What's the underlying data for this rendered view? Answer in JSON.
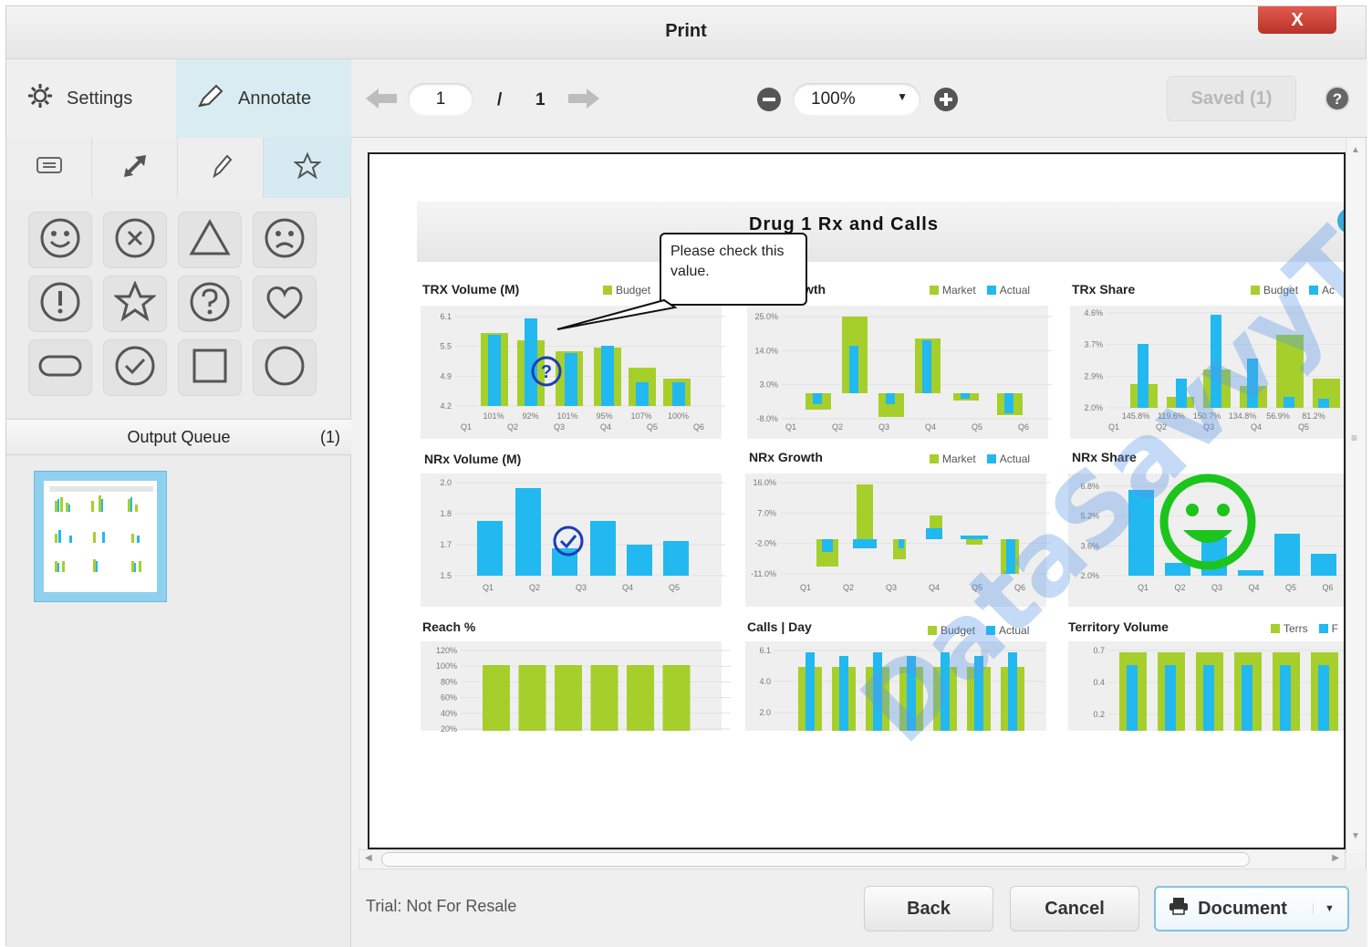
{
  "window": {
    "title": "Print",
    "close_label": "X"
  },
  "left_tabs": {
    "settings_label": "Settings",
    "annotate_label": "Annotate"
  },
  "tools": [
    "comment-icon",
    "arrow-icon",
    "pencil-icon",
    "star-icon"
  ],
  "stamps": [
    "smile",
    "x-circle",
    "triangle",
    "frown",
    "exclamation",
    "star",
    "question",
    "heart",
    "pill",
    "check",
    "square",
    "circle"
  ],
  "queue": {
    "label": "Output Queue",
    "count": "(1)"
  },
  "toolbar": {
    "page": "1",
    "separator": "/",
    "total_pages": "1",
    "zoom": "100%",
    "saved_label": "Saved (1)"
  },
  "dashboard": {
    "title": "Drug 1 Rx and Calls",
    "callout": "Please check this value.",
    "watermark": "DataSavvyTools.com",
    "panels": {
      "trx_volume": {
        "title": "TRX Volume (M)",
        "legend": [
          "Budget"
        ],
        "y_ticks": [
          "6.1",
          "5.5",
          "4.9",
          "4.2"
        ],
        "x": [
          "Q1",
          "Q2",
          "Q3",
          "Q4",
          "Q5",
          "Q6"
        ],
        "pct": [
          "101%",
          "92%",
          "101%",
          "95%",
          "107%",
          "100%"
        ]
      },
      "trx_growth": {
        "title": "wth",
        "legend": [
          "Market",
          "Actual"
        ],
        "y_ticks": [
          "25.0%",
          "14.0%",
          "3.0%",
          "-8.0%"
        ],
        "x": [
          "Q1",
          "Q2",
          "Q3",
          "Q4",
          "Q5",
          "Q6"
        ]
      },
      "trx_share": {
        "title": "TRx Share",
        "legend": [
          "Budget",
          "Ac"
        ],
        "y_ticks": [
          "4.6%",
          "3.7%",
          "2.9%",
          "2.0%"
        ],
        "x": [
          "Q1",
          "Q2",
          "Q3",
          "Q4",
          "Q5"
        ],
        "pct": [
          "145.8%",
          "119.6%",
          "150.7%",
          "134.8%",
          "56.9%",
          "81.2%"
        ]
      },
      "nrx_volume": {
        "title": "NRx Volume (M)",
        "y_ticks": [
          "2.0",
          "1.8",
          "1.7",
          "1.5"
        ],
        "x": [
          "Q1",
          "Q2",
          "Q3",
          "Q4",
          "Q5"
        ]
      },
      "nrx_growth": {
        "title": "NRx Growth",
        "legend": [
          "Market",
          "Actual"
        ],
        "y_ticks": [
          "16.0%",
          "7.0%",
          "-2.0%",
          "-11.0%"
        ],
        "x": [
          "Q1",
          "Q2",
          "Q3",
          "Q4",
          "Q5",
          "Q6"
        ]
      },
      "nrx_share": {
        "title": "NRx Share",
        "y_ticks": [
          "6.8%",
          "5.2%",
          "3.6%",
          "2.0%"
        ],
        "x": [
          "Q1",
          "Q2",
          "Q3",
          "Q4",
          "Q5",
          "Q6"
        ]
      },
      "reach": {
        "title": "Reach %",
        "y_ticks": [
          "120%",
          "100%",
          "80%",
          "60%",
          "40%",
          "20%"
        ]
      },
      "calls_day": {
        "title": "Calls | Day",
        "legend": [
          "Budget",
          "Actual"
        ],
        "y_ticks": [
          "6.1",
          "4.0",
          "2.0"
        ]
      },
      "territory_volume": {
        "title": "Territory Volume",
        "legend": [
          "Terrs",
          "F"
        ],
        "y_ticks": [
          "0.7",
          "0.4",
          "0.2"
        ]
      }
    }
  },
  "bottom": {
    "trial_text": "Trial: Not For Resale",
    "back_label": "Back",
    "cancel_label": "Cancel",
    "document_label": "Document"
  },
  "colors": {
    "green": "#a6cf2c",
    "blue": "#22b8f0",
    "accent": "#7ec2e6",
    "close_red": "#c9392e"
  }
}
